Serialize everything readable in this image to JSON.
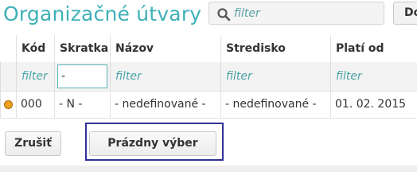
{
  "header": {
    "title": "Organizačné útvary",
    "search_placeholder": "filter",
    "button_label": "Do"
  },
  "table": {
    "columns": [
      "",
      "Kód",
      "Skratka",
      "Názov",
      "Stredisko",
      "Platí od"
    ],
    "filters": {
      "kod": "filter",
      "skratka_value": "-",
      "nazov": "filter",
      "stredisko": "filter",
      "plati_od": "filter"
    },
    "rows": [
      {
        "status_color": "#f0a020",
        "kod": "000",
        "skratka": "- N -",
        "nazov": "- nedefinované -",
        "stredisko": "- nedefinované -",
        "plati_od": "01. 02. 2015"
      }
    ]
  },
  "footer": {
    "cancel_label": "Zrušiť",
    "empty_selection_label": "Prázdny výber"
  }
}
